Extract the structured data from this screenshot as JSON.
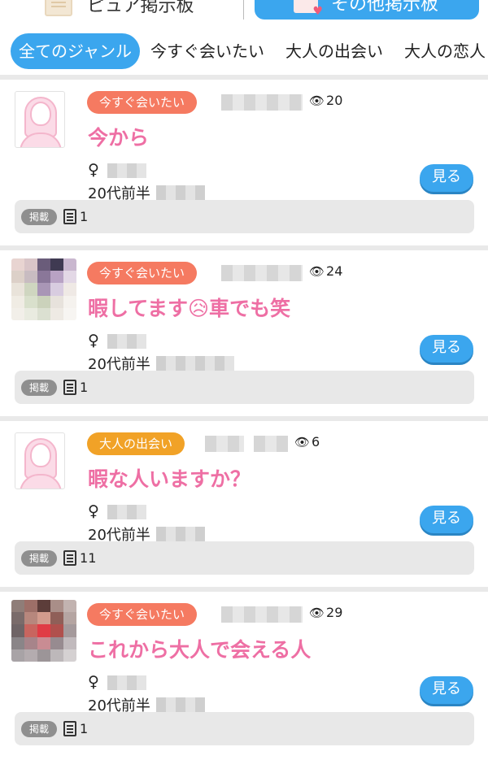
{
  "board_tabs": {
    "left_label": "ピュア掲示板",
    "right_label": "その他掲示板"
  },
  "genres": [
    {
      "label": "全てのジャンル",
      "active": true
    },
    {
      "label": "今すぐ会いたい",
      "active": false
    },
    {
      "label": "大人の出会い",
      "active": false
    },
    {
      "label": "大人の恋人",
      "active": false
    }
  ],
  "posts": [
    {
      "genre": "今すぐ会いたい",
      "genre_type": "now",
      "title": "今から",
      "views": "20",
      "gender": "♀",
      "age": "20代前半",
      "view_label": "見る",
      "post_label": "掲載",
      "post_count": "1",
      "avatar": "silhouette"
    },
    {
      "genre": "今すぐ会いたい",
      "genre_type": "now",
      "title": "暇してます😥車でも笑",
      "views": "24",
      "gender": "♀",
      "age": "20代前半",
      "view_label": "見る",
      "post_label": "掲載",
      "post_count": "1",
      "avatar": "photo"
    },
    {
      "genre": "大人の出会い",
      "genre_type": "adult",
      "title": "暇な人いますか？",
      "views": "6",
      "gender": "♀",
      "age": "20代前半",
      "view_label": "見る",
      "post_label": "掲載",
      "post_count": "11",
      "avatar": "silhouette"
    },
    {
      "genre": "今すぐ会いたい",
      "genre_type": "now",
      "title": "これから大人で会える人",
      "views": "29",
      "gender": "♀",
      "age": "20代前半",
      "view_label": "見る",
      "post_label": "掲載",
      "post_count": "1",
      "avatar": "photo"
    }
  ],
  "colors": {
    "accent_blue": "#3ba6ee",
    "title_pink": "#ee6fa4",
    "tag_now": "#f57a61",
    "tag_adult": "#f1a227"
  }
}
